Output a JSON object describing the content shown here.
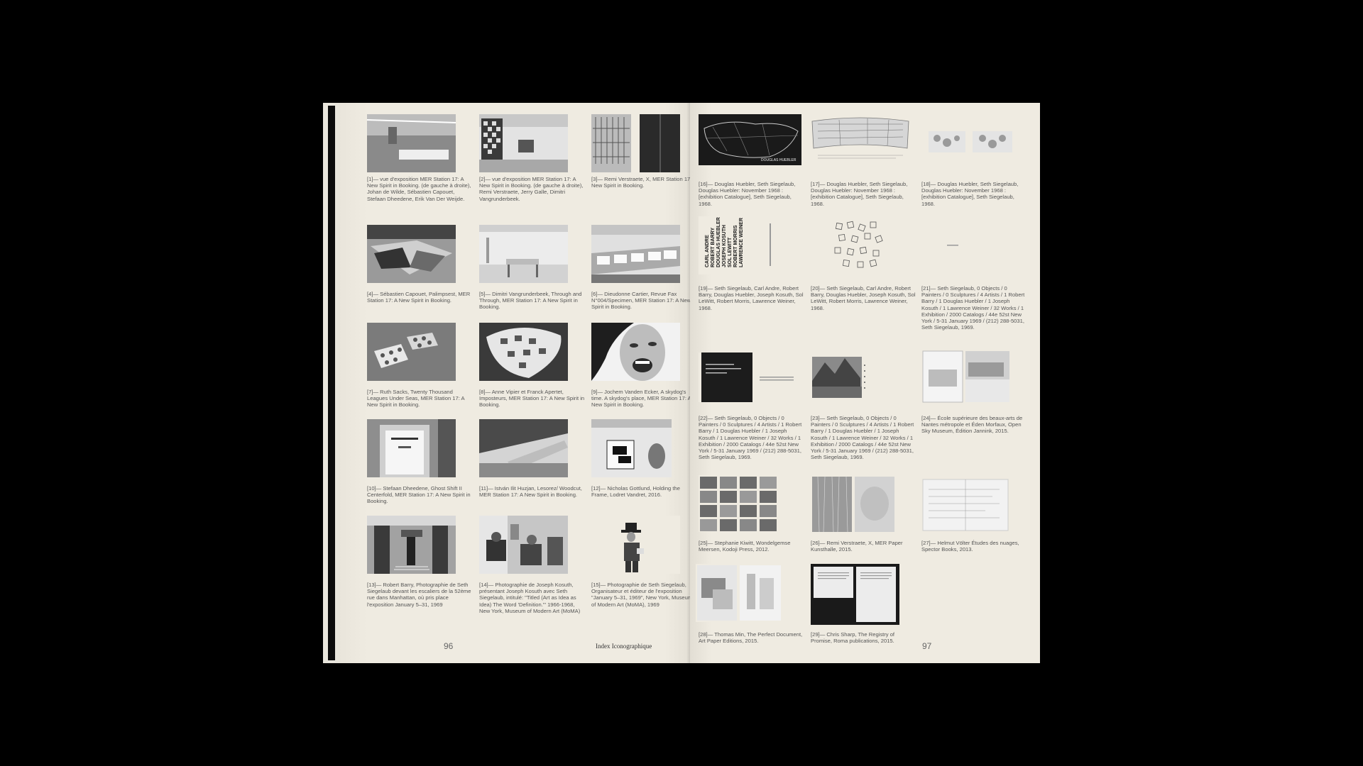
{
  "left_page": {
    "folio": "96",
    "running_head": "Index Iconographique",
    "captions": [
      "[1]— vue d'exposition MER Station 17: A New Spirit in Booking. (de gauche à droite), Johan de Wilde, Sébastien Capouet, Stefaan Dheedene, Erik Van Der Weijde.",
      "[2]— vue d'exposition MER Station 17: A New Spirit in Booking. (de gauche à droite), Remi Verstraete, Jerry Galle, Dimitri Vangrunderbeek.",
      "[3]— Remi Verstraete, X, MER Station 17: A New Spirit in Booking.",
      "[4]— Sébastien Capouet, Palimpsest, MER Station 17: A New Spirit in Booking.",
      "[5]— Dimitri Vangrunderbeek, Through and Through, MER Station 17: A New Spirit in Booking.",
      "[6]— Dieudonne Cartier, Revue Fax N°004/Specimen, MER Station 17: A New Spirit in Booking.",
      "[7]— Ruth Sacks, Twenty Thousand Leagues Under Seas, MER Station 17: A New Spirit in Booking.",
      "[8]— Anne Vipier et Franck Apertet, Imposteurs, MER Station 17: A New Spirit in Booking.",
      "[9]— Jochem Vanden Ecker, A skydog's time. A skydog's place, MER Station 17: A New Spirit in Booking.",
      "[10]— Stefaan Dheedene, Ghost Shift II Centerfold, MER Station 17: A New Spirit in Booking.",
      "[11]— István Ilit Huzjan, Lesorez/ Woodcut, MER Station 17: A New Spirit in Booking.",
      "[12]— Nicholas Gottlund, Holding the Frame, Lodret Vandret, 2016.",
      "[13]— Robert Barry, Photographie de Seth Siegelaub devant les escaliers de la 52ème rue dans Manhattan, où pris place l'exposition January 5–31, 1969",
      "[14]— Photographie de Joseph Kosuth, présentant Joseph Kosuth avec Seth Siegelaub, intitulé: \"Titled (Art as Idea as Idea) The Word 'Definition.'\" 1966-1968, New York, Museum of Modern Art (MoMA)",
      "[15]— Photographie de Seth Siegelaub, Organisateur et éditeur de l'exposition \"January 5–31, 1969\", New York, Museum of Modern Art (MoMA), 1969"
    ]
  },
  "right_page": {
    "folio": "97",
    "captions": [
      "[16]— Douglas Huebler, Seth Siegelaub, Douglas Huebler: November 1968 : [exhibition Catalogue], Seth Siegelaub, 1968.",
      "[17]— Douglas Huebler, Seth Siegelaub, Douglas Huebler: November 1968 : [exhibition Catalogue], Seth Siegelaub, 1968.",
      "[18]— Douglas Huebler, Seth Siegelaub, Douglas Huebler: November 1968 : [exhibition Catalogue], Seth Siegelaub, 1968.",
      "[19]— Seth Siegelaub, Carl Andre, Robert Barry, Douglas Huebler, Joseph Kosuth, Sol LeWitt, Robert Morris, Lawrence Weiner, 1968.",
      "[20]— Seth Siegelaub, Carl Andre, Robert Barry, Douglas Huebler, Joseph Kosuth, Sol LeWitt, Robert Morris, Lawrence Weiner, 1968.",
      "[21]— Seth Siegelaub, 0 Objects / 0 Painters / 0 Sculptures / 4 Artists / 1 Robert Barry / 1 Douglas Huebler / 1 Joseph Kosuth / 1 Lawrence Weiner / 32 Works / 1 Exhibition / 2000 Catalogs / 44e 52st New York / 5-31 January 1969 / (212) 288-5031, Seth Siegelaub, 1969.",
      "[22]— Seth Siegelaub, 0 Objects / 0 Painters / 0 Sculptures / 4 Artists / 1 Robert Barry / 1 Douglas Huebler / 1 Joseph Kosuth / 1 Lawrence Weiner / 32 Works / 1 Exhibition / 2000 Catalogs / 44e 52st New York / 5-31 January 1969 / (212) 288-5031, Seth Siegelaub, 1969.",
      "[23]— Seth Siegelaub, 0 Objects / 0 Painters / 0 Sculptures / 4 Artists / 1 Robert Barry / 1 Douglas Huebler / 1 Joseph Kosuth / 1 Lawrence Weiner / 32 Works / 1 Exhibition / 2000 Catalogs / 44e 52st New York / 5-31 January 1969 / (212) 288-5031, Seth Siegelaub, 1969.",
      "[24]— École supérieure des beaux-arts de Nantes métropole et Éden Morfaux, Open Sky Museum, Édition Jannink, 2015.",
      "[25]— Stephanie Kiwitt, Wondelgemse Meersen, Kodoji Press, 2012.",
      "[26]— Remi Verstraete, X, MER Paper Kunsthalle, 2015.",
      "[27]— Helmut Völter Études des nuages, Spector Books, 2013.",
      "[28]— Thomas Min, The Perfect Document, Art Paper Editions, 2015.",
      "[29]— Chris Sharp, The Registry of Promise, Roma publications, 2015."
    ],
    "image_texts": {
      "map_label": "DOUGLAS HUEBLER",
      "book19_lines": [
        "CARL ANDRE",
        "ROBERT BARRY",
        "DOUGLAS HUEBLER",
        "JOSEPH KOSUTH",
        "SOL LEWITT",
        "ROBERT MORRIS",
        "LAWRENCE WEINER"
      ]
    }
  }
}
